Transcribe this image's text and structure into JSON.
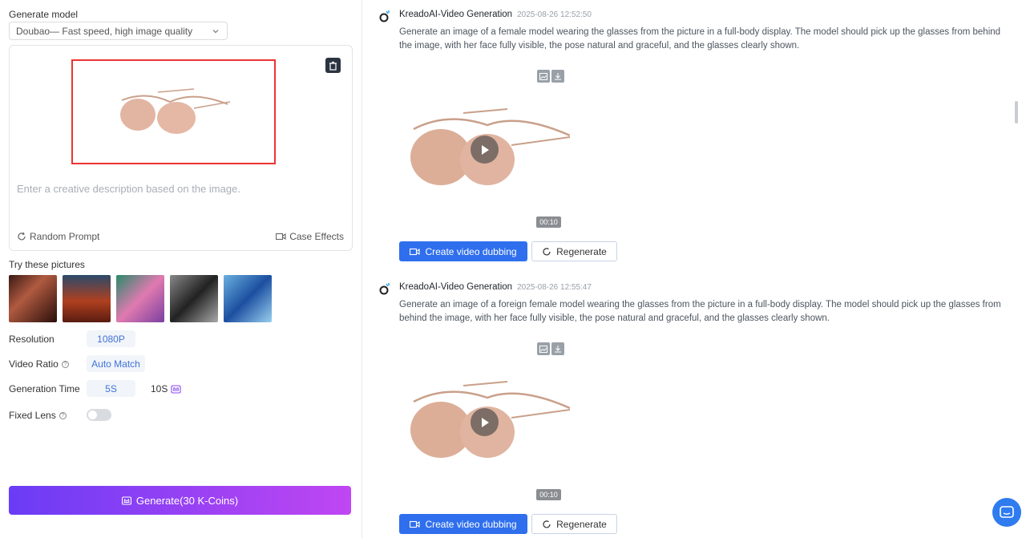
{
  "left": {
    "model_label": "Generate model",
    "model_value": "Doubao— Fast speed, high image quality",
    "prompt_placeholder": "Enter a creative description based on the image.",
    "random_prompt": "Random Prompt",
    "case_effects": "Case Effects",
    "try_label": "Try these pictures",
    "resolution_label": "Resolution",
    "resolution_value": "1080P",
    "ratio_label": "Video Ratio",
    "ratio_value": "Auto Match",
    "time_label": "Generation Time",
    "time_5s": "5S",
    "time_10s": "10S",
    "fixed_lens_label": "Fixed Lens",
    "fixed_lens_on": false,
    "generate_label": "Generate(30 K-Coins)"
  },
  "messages": [
    {
      "title": "KreadoAI-Video Generation",
      "time": "2025-08-26 12:52:50",
      "text": "Generate an image of a female model wearing the glasses from the picture in a full-body display. The model should pick up the glasses from behind the image, with her face fully visible, the pose natural and graceful, and the glasses clearly shown.",
      "duration": "00:10",
      "dub_label": "Create video dubbing",
      "regen_label": "Regenerate"
    },
    {
      "title": "KreadoAI-Video Generation",
      "time": "2025-08-26 12:55:47",
      "text": "Generate an image of a foreign female model wearing the glasses from the picture in a full-body display. The model should pick up the glasses from behind the image, with her face fully visible, the pose natural and graceful, and the glasses clearly shown.",
      "duration": "00:10",
      "dub_label": "Create video dubbing",
      "regen_label": "Regenerate"
    }
  ],
  "colors": {
    "accent_blue": "#2f6fed",
    "generate_gradient_start": "#6a3cf5",
    "generate_gradient_end": "#c046f2",
    "highlight_red": "#e33333"
  },
  "icons": [
    "chevron-down-icon",
    "trash-icon",
    "refresh-icon",
    "video-icon",
    "help-icon",
    "crown-icon",
    "image-icon",
    "download-icon",
    "play-icon",
    "chat-icon"
  ]
}
